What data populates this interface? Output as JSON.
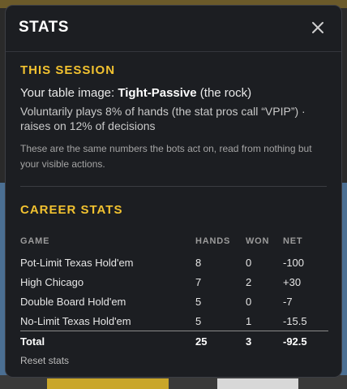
{
  "modal": {
    "title": "STATS",
    "close_icon": "close-icon"
  },
  "session": {
    "heading": "THIS SESSION",
    "image_prefix": "Your table image: ",
    "image_type": "Tight-Passive",
    "image_suffix": " (the rock)",
    "vpip_line": "Voluntarily plays 8% of hands (the stat pros call “VPIP”) · raises on 12% of decisions",
    "note": "These are the same numbers the bots act on, read from nothing but your visible actions."
  },
  "career": {
    "heading": "CAREER STATS",
    "columns": [
      "GAME",
      "HANDS",
      "WON",
      "NET"
    ],
    "rows": [
      {
        "game": "Pot-Limit Texas Hold'em",
        "hands": "8",
        "won": "0",
        "net": "-100"
      },
      {
        "game": "High Chicago",
        "hands": "7",
        "won": "2",
        "net": "+30"
      },
      {
        "game": "Double Board Hold'em",
        "hands": "5",
        "won": "0",
        "net": "-7"
      },
      {
        "game": "No-Limit Texas Hold'em",
        "hands": "5",
        "won": "1",
        "net": "-15.5"
      }
    ],
    "total": {
      "label": "Total",
      "hands": "25",
      "won": "3",
      "net": "-92.5"
    },
    "reset_label": "Reset stats"
  },
  "colors": {
    "accent": "#f2c230",
    "modal_bg": "#1c1e22"
  }
}
